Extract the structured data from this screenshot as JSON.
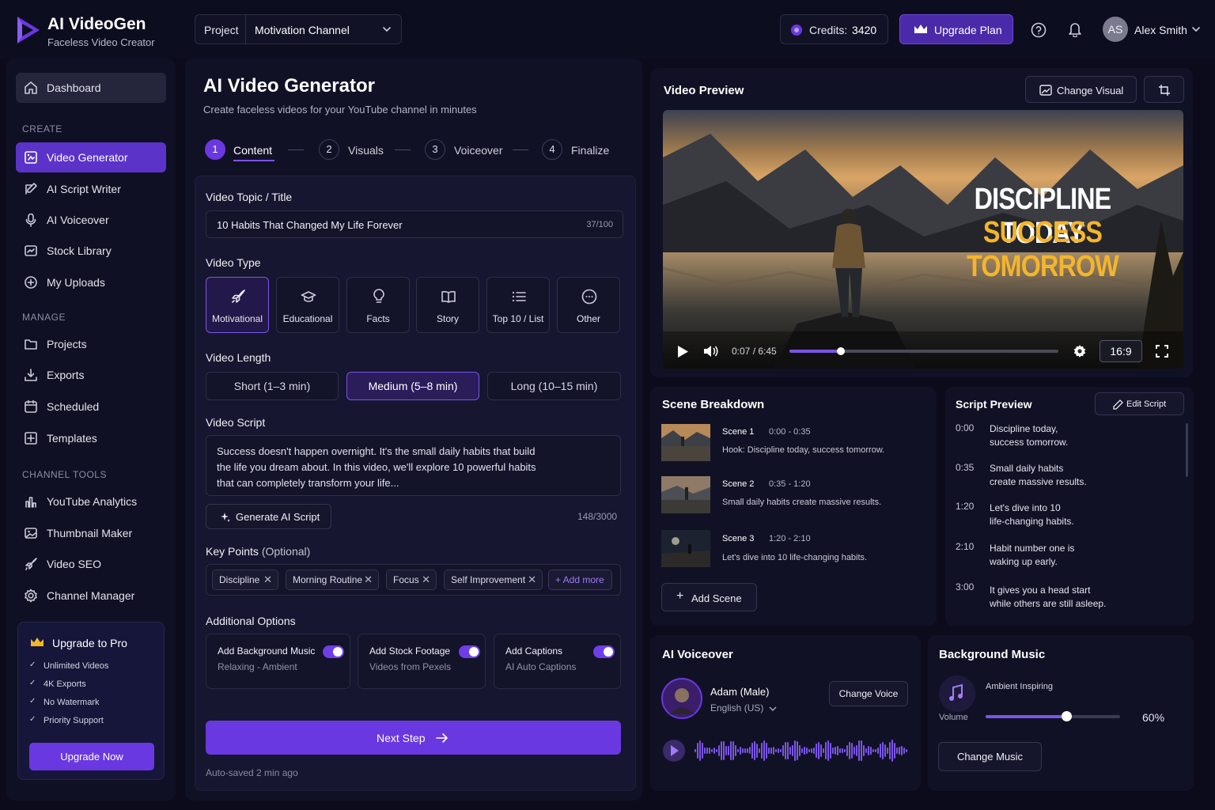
{
  "app": {
    "name": "AI VideoGen",
    "tagline": "Faceless Video Creator"
  },
  "topbar": {
    "project_label": "Project",
    "project_value": "Motivation Channel",
    "credits_label": "Credits:",
    "credits_value": "3420",
    "upgrade_label": "Upgrade Plan",
    "user_initials": "AS",
    "user_name": "Alex Smith"
  },
  "sidebar": {
    "dashboard": "Dashboard",
    "create_heading": "CREATE",
    "create_items": [
      "Video Generator",
      "AI Script Writer",
      "AI Voiceover",
      "Stock Library",
      "My Uploads"
    ],
    "manage_heading": "MANAGE",
    "manage_items": [
      "Projects",
      "Exports",
      "Scheduled",
      "Templates"
    ],
    "tools_heading": "CHANNEL TOOLS",
    "tools_items": [
      "YouTube Analytics",
      "Thumbnail Maker",
      "Video SEO",
      "Channel Manager"
    ],
    "pro": {
      "title": "Upgrade to Pro",
      "features": [
        "Unlimited Videos",
        "4K Exports",
        "No Watermark",
        "Priority Support"
      ],
      "button": "Upgrade Now"
    }
  },
  "generator": {
    "title": "AI Video Generator",
    "subtitle": "Create faceless videos for your YouTube channel in minutes",
    "steps": [
      {
        "num": "1",
        "label": "Content"
      },
      {
        "num": "2",
        "label": "Visuals"
      },
      {
        "num": "3",
        "label": "Voiceover"
      },
      {
        "num": "4",
        "label": "Finalize"
      }
    ],
    "topic_label": "Video Topic / Title",
    "topic_value": "10 Habits That Changed My Life Forever",
    "topic_count": "37/100",
    "type_label": "Video Type",
    "types": [
      "Motivational",
      "Educational",
      "Facts",
      "Story",
      "Top 10 / List",
      "Other"
    ],
    "selected_type": "Motivational",
    "length_label": "Video Length",
    "lengths": [
      "Short (1–3 min)",
      "Medium (5–8 min)",
      "Long (10–15 min)"
    ],
    "selected_length": "Medium (5–8 min)",
    "script_label": "Video Script",
    "script_lines": [
      "Success doesn't happen overnight. It's the small daily habits that build",
      "the life you dream about. In this video, we'll explore 10 powerful habits",
      "that can completely transform your life..."
    ],
    "generate_button": "Generate AI Script",
    "script_count": "148/3000",
    "keypoints_label": "Key Points",
    "keypoints_optional": "(Optional)",
    "keypoints": [
      "Discipline",
      "Morning Routine",
      "Focus",
      "Self Improvement"
    ],
    "add_more": "+ Add more",
    "options_label": "Additional Options",
    "options": [
      {
        "title": "Add Background Music",
        "sub": "Relaxing - Ambient",
        "on": true
      },
      {
        "title": "Add Stock Footage",
        "sub": "Videos from Pexels",
        "on": true
      },
      {
        "title": "Add Captions",
        "sub": "AI Auto Captions",
        "on": true
      }
    ],
    "next_button": "Next Step",
    "autosave": "Auto-saved 2 min ago"
  },
  "preview": {
    "title": "Video Preview",
    "change_visual": "Change Visual",
    "overlay_line1": "DISCIPLINE TODAY",
    "overlay_line2": "SUCCESS TOMORROW",
    "time": "0:07 / 6:45",
    "progress": 0.19,
    "aspect": "16:9"
  },
  "scenes": {
    "title": "Scene Breakdown",
    "items": [
      {
        "name": "Scene 1",
        "time": "0:00 - 0:35",
        "desc": "Hook: Discipline today, success tomorrow."
      },
      {
        "name": "Scene 2",
        "time": "0:35 - 1:20",
        "desc": "Small daily habits create massive results."
      },
      {
        "name": "Scene 3",
        "time": "1:20 - 2:10",
        "desc": "Let's dive into 10 life-changing habits."
      }
    ],
    "add_scene": "Add Scene"
  },
  "script_preview": {
    "title": "Script Preview",
    "edit": "Edit Script",
    "lines": [
      {
        "time": "0:00",
        "l1": "Discipline today,",
        "l2": "success tomorrow."
      },
      {
        "time": "0:35",
        "l1": "Small daily habits",
        "l2": "create massive results."
      },
      {
        "time": "1:20",
        "l1": "Let's dive into 10",
        "l2": "life-changing habits."
      },
      {
        "time": "2:10",
        "l1": "Habit number one is",
        "l2": "waking up early."
      },
      {
        "time": "3:00",
        "l1": "It gives you a head start",
        "l2": "while others are still asleep."
      }
    ]
  },
  "voiceover": {
    "title": "AI Voiceover",
    "voice": "Adam (Male)",
    "language": "English (US)",
    "change": "Change Voice"
  },
  "music": {
    "title": "Background Music",
    "track": "Ambient Inspiring",
    "volume_label": "Volume",
    "volume_value": "60%",
    "volume": 0.6,
    "change": "Change Music"
  },
  "colors": {
    "accent": "#6a38e0",
    "bg": "#0b0b1c",
    "panel": "#111126",
    "title_gold": "#f4b52c"
  }
}
